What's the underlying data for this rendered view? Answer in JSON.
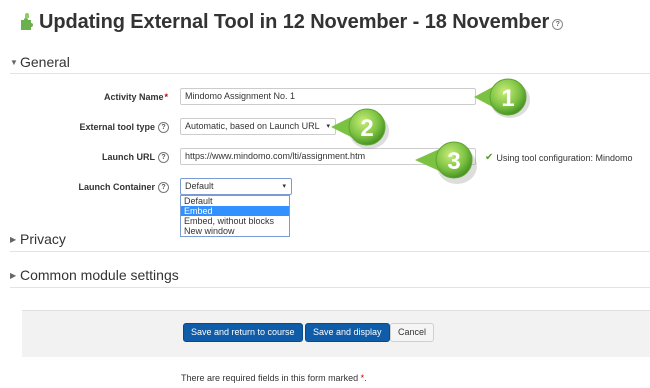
{
  "page": {
    "title": "Updating External Tool in 12 November - 18 November",
    "help_symbol": "?"
  },
  "sections": {
    "general": "General",
    "privacy": "Privacy",
    "common": "Common module settings"
  },
  "form": {
    "activity_name": {
      "label": "Activity Name",
      "required_mark": "*",
      "value": "Mindomo Assignment No. 1"
    },
    "external_tool_type": {
      "label": "External tool type",
      "value": "Automatic, based on Launch URL",
      "caret": "▾"
    },
    "launch_url": {
      "label": "Launch URL",
      "value": "https://www.mindomo.com/lti/assignment.htm",
      "status": "Using tool configuration: Mindomo"
    },
    "launch_container": {
      "label": "Launch Container",
      "value": "Default",
      "caret": "▾",
      "options": [
        "Default",
        "Embed",
        "Embed, without blocks",
        "New window"
      ],
      "highlighted_option": "Embed"
    }
  },
  "callouts": [
    "1",
    "2",
    "3"
  ],
  "buttons": {
    "save_return": "Save and return to course",
    "save_display": "Save and display",
    "cancel": "Cancel"
  },
  "footer": {
    "required_note": "There are required fields in this form marked",
    "required_mark": "*."
  },
  "icons": {
    "puzzle": "puzzle-icon",
    "help": "help-icon",
    "check": "check-icon",
    "collapse": "triangle-down-icon",
    "expand": "triangle-right-icon"
  },
  "colors": {
    "primary_button": "#0f5ca8",
    "callout_green": "#7cc242",
    "required": "#cc0000",
    "dropdown_highlight": "#3390ff"
  }
}
